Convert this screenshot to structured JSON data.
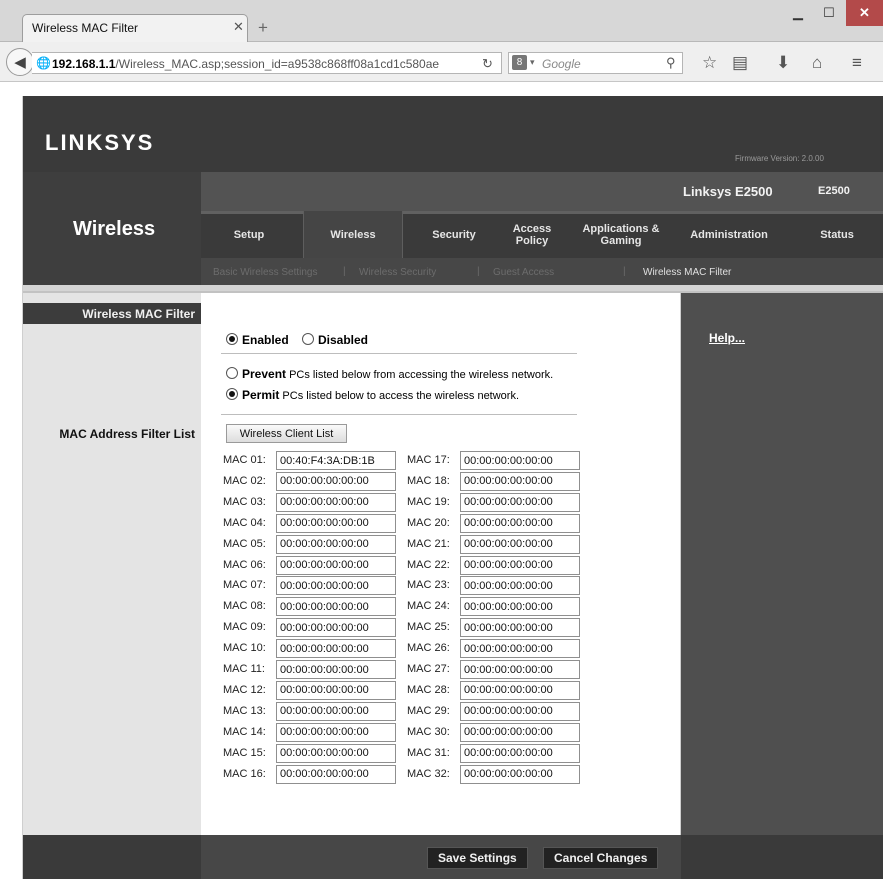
{
  "browser": {
    "tab_title": "Wireless MAC Filter",
    "url_host": "192.168.1.1",
    "url_path": "/Wireless_MAC.asp;session_id=a9538c868ff08a1cd1c580ae",
    "search_engine_glyph": "8",
    "search_placeholder": "Google"
  },
  "router": {
    "logo": "LINKSYS",
    "firmware": "Firmware Version: 2.0.00",
    "section_title": "Wireless",
    "model_name": "Linksys E2500",
    "model_number": "E2500",
    "tabs": [
      {
        "label": "Setup"
      },
      {
        "label": "Wireless"
      },
      {
        "label": "Security"
      },
      {
        "label": "Access Policy"
      },
      {
        "label": "Applications & Gaming"
      },
      {
        "label": "Administration"
      },
      {
        "label": "Status"
      }
    ],
    "subtabs": [
      {
        "label": "Basic Wireless Settings"
      },
      {
        "label": "Wireless Security"
      },
      {
        "label": "Guest Access"
      },
      {
        "label": "Wireless MAC Filter"
      }
    ]
  },
  "left": {
    "panel_heading": "Wireless MAC Filter",
    "list_label": "MAC Address Filter List"
  },
  "form": {
    "enabled_label": "Enabled",
    "disabled_label": "Disabled",
    "prevent_bold": "Prevent",
    "prevent_rest": "PCs listed below from accessing the wireless network.",
    "permit_bold": "Permit",
    "permit_rest": "PCs listed below to access the wireless network.",
    "client_list_button": "Wireless Client List",
    "mac_left": [
      {
        "label": "MAC 01:",
        "value": "00:40:F4:3A:DB:1B"
      },
      {
        "label": "MAC 02:",
        "value": "00:00:00:00:00:00"
      },
      {
        "label": "MAC 03:",
        "value": "00:00:00:00:00:00"
      },
      {
        "label": "MAC 04:",
        "value": "00:00:00:00:00:00"
      },
      {
        "label": "MAC 05:",
        "value": "00:00:00:00:00:00"
      },
      {
        "label": "MAC 06:",
        "value": "00:00:00:00:00:00"
      },
      {
        "label": "MAC 07:",
        "value": "00:00:00:00:00:00"
      },
      {
        "label": "MAC 08:",
        "value": "00:00:00:00:00:00"
      },
      {
        "label": "MAC 09:",
        "value": "00:00:00:00:00:00"
      },
      {
        "label": "MAC 10:",
        "value": "00:00:00:00:00:00"
      },
      {
        "label": "MAC 11:",
        "value": "00:00:00:00:00:00"
      },
      {
        "label": "MAC 12:",
        "value": "00:00:00:00:00:00"
      },
      {
        "label": "MAC 13:",
        "value": "00:00:00:00:00:00"
      },
      {
        "label": "MAC 14:",
        "value": "00:00:00:00:00:00"
      },
      {
        "label": "MAC 15:",
        "value": "00:00:00:00:00:00"
      },
      {
        "label": "MAC 16:",
        "value": "00:00:00:00:00:00"
      }
    ],
    "mac_right": [
      {
        "label": "MAC 17:",
        "value": "00:00:00:00:00:00"
      },
      {
        "label": "MAC 18:",
        "value": "00:00:00:00:00:00"
      },
      {
        "label": "MAC 19:",
        "value": "00:00:00:00:00:00"
      },
      {
        "label": "MAC 20:",
        "value": "00:00:00:00:00:00"
      },
      {
        "label": "MAC 21:",
        "value": "00:00:00:00:00:00"
      },
      {
        "label": "MAC 22:",
        "value": "00:00:00:00:00:00"
      },
      {
        "label": "MAC 23:",
        "value": "00:00:00:00:00:00"
      },
      {
        "label": "MAC 24:",
        "value": "00:00:00:00:00:00"
      },
      {
        "label": "MAC 25:",
        "value": "00:00:00:00:00:00"
      },
      {
        "label": "MAC 26:",
        "value": "00:00:00:00:00:00"
      },
      {
        "label": "MAC 27:",
        "value": "00:00:00:00:00:00"
      },
      {
        "label": "MAC 28:",
        "value": "00:00:00:00:00:00"
      },
      {
        "label": "MAC 29:",
        "value": "00:00:00:00:00:00"
      },
      {
        "label": "MAC 30:",
        "value": "00:00:00:00:00:00"
      },
      {
        "label": "MAC 31:",
        "value": "00:00:00:00:00:00"
      },
      {
        "label": "MAC 32:",
        "value": "00:00:00:00:00:00"
      }
    ]
  },
  "help": {
    "link": "Help..."
  },
  "footer": {
    "save": "Save Settings",
    "cancel": "Cancel Changes"
  }
}
